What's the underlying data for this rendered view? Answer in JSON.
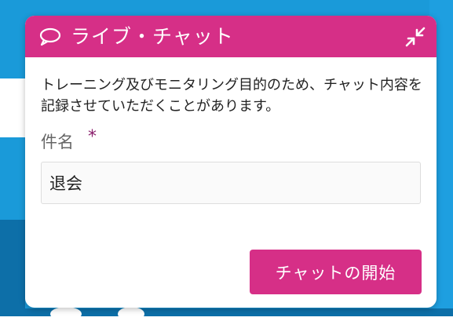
{
  "header": {
    "title": "ライブ・チャット",
    "chat_icon": "chat-bubble-icon",
    "minimize_icon": "collapse-arrows-icon"
  },
  "body": {
    "notice": "トレーニング及びモニタリング目的のため、チャット内容を記録させていただくことがあります。",
    "subject_label": "件名",
    "required_mark": "*",
    "subject_value": "退会"
  },
  "actions": {
    "start_label": "チャットの開始"
  },
  "colors": {
    "accent": "#d62f87",
    "background": "#1a9ad9",
    "required": "#8a1f6c"
  }
}
